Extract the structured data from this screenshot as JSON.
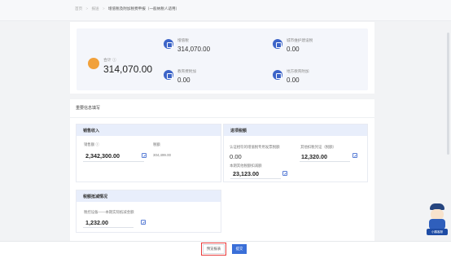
{
  "breadcrumb": {
    "home": "首页",
    "section": "报送",
    "current": "增值税及附加税费申报（一般纳税人适用）"
  },
  "summary": {
    "total_label": "合计",
    "total_value": "314,070.00",
    "metrics": [
      {
        "label": "增值税",
        "value": "314,070.00"
      },
      {
        "label": "城市维护建设税",
        "value": "0.00"
      },
      {
        "label": "教育费附加",
        "value": "0.00"
      },
      {
        "label": "地方教育附加",
        "value": "0.00"
      }
    ]
  },
  "info_section": {
    "title": "重要信息填写",
    "sales": {
      "title": "销售收入",
      "sales_amount_label": "销售额",
      "sales_amount": "2,342,300.00",
      "tax_label": "税额",
      "tax_value": "304,499.00"
    },
    "input_tax": {
      "title": "进项税额",
      "deductible_label": "认证相符的增值税专用发票税额",
      "deductible_value": "0.00",
      "other_label": "其他扣税凭证（税额）",
      "other_value": "12,320.00",
      "current_label": "本期其他税额扣减额",
      "current_value": "23,123.00"
    },
    "tax_reduction": {
      "title": "税额抵减情况",
      "field_label": "税控设备——本期实际抵减金额",
      "field_value": "1,232.00"
    }
  },
  "actions": {
    "preview": "预览报表",
    "submit": "提交"
  },
  "mascot": {
    "caption": "小鹏客服"
  }
}
